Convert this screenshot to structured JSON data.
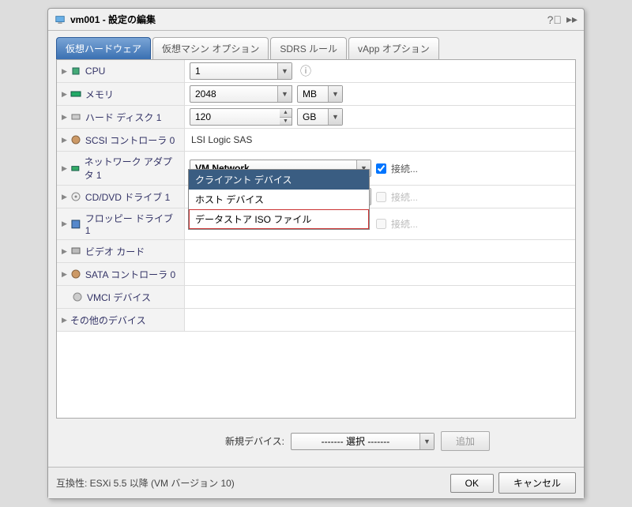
{
  "title": "vm001 - 設定の編集",
  "tabs": [
    "仮想ハードウェア",
    "仮想マシン オプション",
    "SDRS ルール",
    "vApp オプション"
  ],
  "rows": {
    "cpu": {
      "label": "CPU",
      "value": "1"
    },
    "memory": {
      "label": "メモリ",
      "value": "2048",
      "unit": "MB"
    },
    "disk": {
      "label": "ハード ディスク 1",
      "value": "120",
      "unit": "GB"
    },
    "scsi": {
      "label": "SCSI コントローラ 0",
      "value": "LSI Logic SAS"
    },
    "net": {
      "label": "ネットワーク アダプタ 1",
      "value": "VM Network",
      "connect": "接続..."
    },
    "cd": {
      "label": "CD/DVD ドライブ 1",
      "value": "クライアント デバイス",
      "connect": "接続..."
    },
    "floppy": {
      "label": "フロッピー ドライブ 1",
      "connect": "接続..."
    },
    "video": {
      "label": "ビデオ カード"
    },
    "sata": {
      "label": "SATA コントローラ 0"
    },
    "vmci": {
      "label": "VMCI デバイス"
    },
    "other": {
      "label": "その他のデバイス"
    }
  },
  "dropdown": {
    "items": [
      "クライアント デバイス",
      "ホスト デバイス",
      "データストア ISO ファイル"
    ]
  },
  "newdev": {
    "label": "新規デバイス:",
    "select": "------- 選択 -------",
    "add": "追加"
  },
  "footer": {
    "compat": "互換性: ESXi 5.5 以降 (VM バージョン 10)",
    "ok": "OK",
    "cancel": "キャンセル"
  }
}
